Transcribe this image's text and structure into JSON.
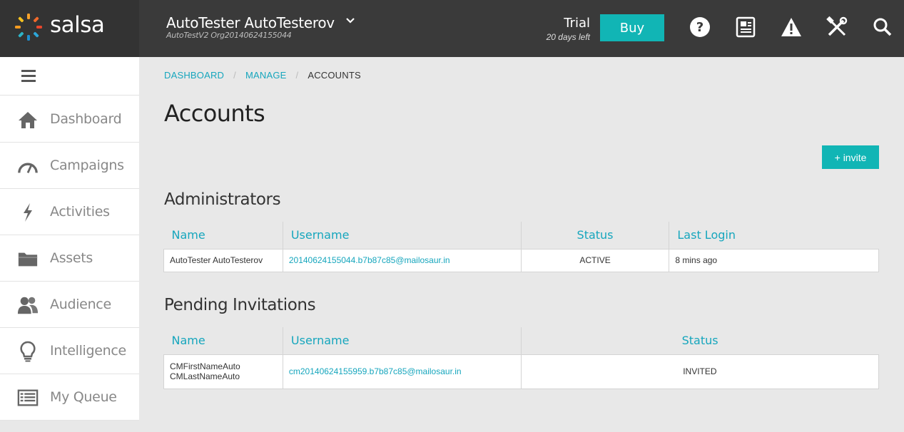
{
  "app": {
    "logo_text": "salsa"
  },
  "header": {
    "user_name": "AutoTester AutoTesterov",
    "org": "AutoTestV2 Org20140624155044",
    "trial_label": "Trial",
    "trial_days": "20 days left",
    "buy_label": "Buy",
    "icons": [
      "help-icon",
      "news-icon",
      "alert-icon",
      "tools-icon",
      "search-icon"
    ]
  },
  "sidebar": {
    "items": [
      {
        "label": "Dashboard",
        "icon": "home-icon"
      },
      {
        "label": "Campaigns",
        "icon": "speedometer-icon"
      },
      {
        "label": "Activities",
        "icon": "lightning-icon"
      },
      {
        "label": "Assets",
        "icon": "folder-icon"
      },
      {
        "label": "Audience",
        "icon": "people-icon"
      },
      {
        "label": "Intelligence",
        "icon": "lightbulb-icon"
      },
      {
        "label": "My Queue",
        "icon": "list-icon"
      }
    ]
  },
  "breadcrumb": {
    "items": [
      "DASHBOARD",
      "MANAGE",
      "ACCOUNTS"
    ]
  },
  "page": {
    "title": "Accounts",
    "invite_label": "+ invite"
  },
  "administrators": {
    "title": "Administrators",
    "columns": [
      "Name",
      "Username",
      "Status",
      "Last Login"
    ],
    "rows": [
      {
        "name": "AutoTester AutoTesterov",
        "username": "20140624155044.b7b87c85@mailosaur.in",
        "status": "ACTIVE",
        "last_login": "8 mins ago"
      }
    ]
  },
  "pending": {
    "title": "Pending Invitations",
    "columns": [
      "Name",
      "Username",
      "Status"
    ],
    "rows": [
      {
        "first_name": "CMFirstNameAuto",
        "last_name": "CMLastNameAuto",
        "username": "cm20140624155959.b7b87c85@mailosaur.in",
        "status": "INVITED"
      }
    ]
  },
  "colors": {
    "accent": "#11b5b5",
    "link": "#16a6bd",
    "topbar": "#3a3a3a"
  }
}
